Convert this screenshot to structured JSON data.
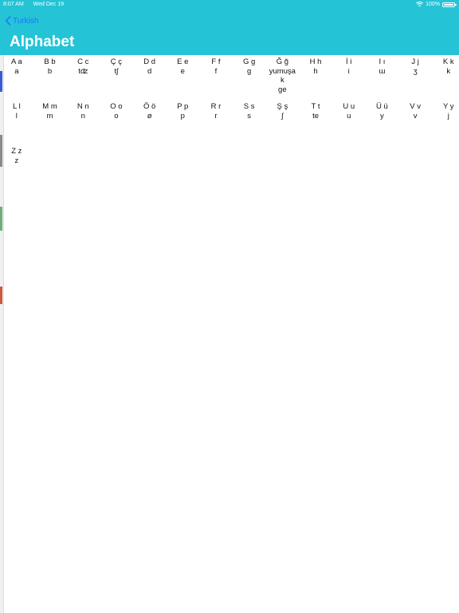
{
  "status_bar": {
    "time": "8:07 AM",
    "date": "Wed Dec 19",
    "battery": "100%"
  },
  "nav": {
    "back_label": "Turkish",
    "title": "Alphabet"
  },
  "letters": [
    {
      "pair": "A a",
      "lines": [
        "a"
      ]
    },
    {
      "pair": "B b",
      "lines": [
        "b"
      ]
    },
    {
      "pair": "C c",
      "lines": [
        "tʣ"
      ]
    },
    {
      "pair": "Ç ç",
      "lines": [
        "tʃ"
      ]
    },
    {
      "pair": "D d",
      "lines": [
        "d"
      ]
    },
    {
      "pair": "E e",
      "lines": [
        "e"
      ]
    },
    {
      "pair": "F f",
      "lines": [
        "f"
      ]
    },
    {
      "pair": "G g",
      "lines": [
        "g"
      ]
    },
    {
      "pair": "Ğ ğ",
      "lines": [
        "yumuşa",
        "k",
        "ge"
      ]
    },
    {
      "pair": "H h",
      "lines": [
        "h"
      ]
    },
    {
      "pair": "İ i",
      "lines": [
        "i"
      ]
    },
    {
      "pair": "I ı",
      "lines": [
        "ɯ"
      ]
    },
    {
      "pair": "J j",
      "lines": [
        "ʒ"
      ]
    },
    {
      "pair": "K k",
      "lines": [
        "k"
      ]
    },
    {
      "pair": "L l",
      "lines": [
        "l"
      ]
    },
    {
      "pair": "M m",
      "lines": [
        "m"
      ]
    },
    {
      "pair": "N n",
      "lines": [
        "n"
      ]
    },
    {
      "pair": "O o",
      "lines": [
        "o"
      ]
    },
    {
      "pair": "Ö ö",
      "lines": [
        "ø"
      ]
    },
    {
      "pair": "P p",
      "lines": [
        "p"
      ]
    },
    {
      "pair": "R r",
      "lines": [
        "r"
      ]
    },
    {
      "pair": "S s",
      "lines": [
        "s"
      ]
    },
    {
      "pair": "Ş ş",
      "lines": [
        "ʃ"
      ]
    },
    {
      "pair": "T t",
      "lines": [
        "te"
      ]
    },
    {
      "pair": "U u",
      "lines": [
        "u"
      ]
    },
    {
      "pair": "Ü ü",
      "lines": [
        "y"
      ]
    },
    {
      "pair": "V v",
      "lines": [
        "v"
      ]
    },
    {
      "pair": "Y y",
      "lines": [
        "j"
      ]
    },
    {
      "pair": "Z z",
      "lines": [
        "z"
      ]
    }
  ]
}
